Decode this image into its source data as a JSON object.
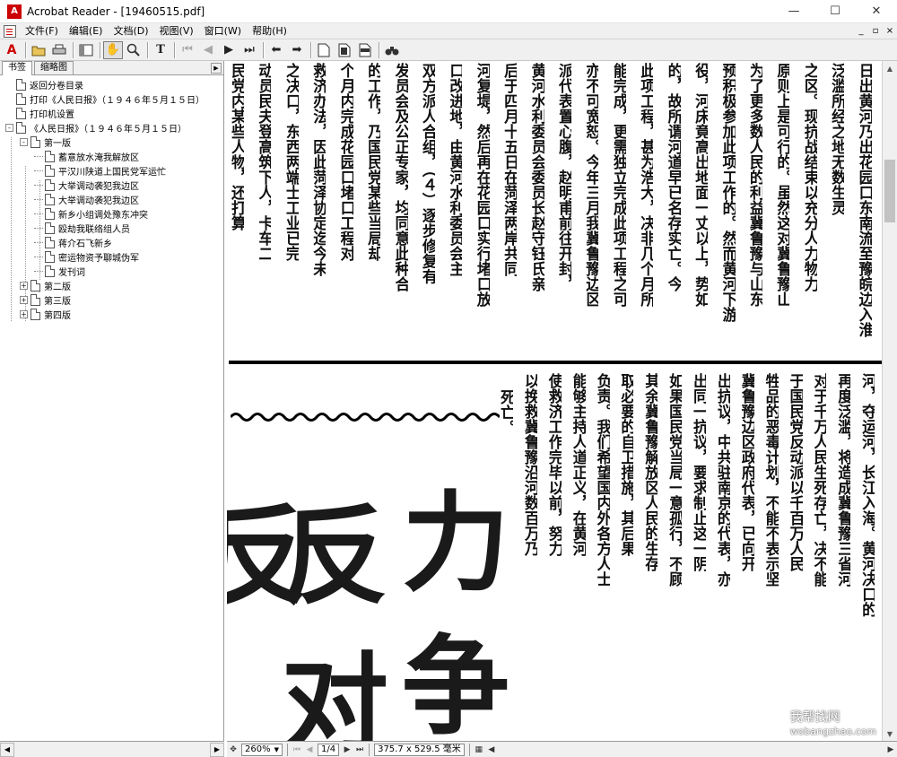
{
  "window": {
    "title": "Acrobat Reader - [19460515.pdf]",
    "app_icon_letter": "A",
    "controls": {
      "minimize": "—",
      "maximize": "☐",
      "close": "✕"
    }
  },
  "menubar": {
    "items": [
      "文件(F)",
      "编辑(E)",
      "文档(D)",
      "视图(V)",
      "窗口(W)",
      "帮助(H)"
    ],
    "mdi": {
      "minimize": "_",
      "restore": "▫",
      "close": "×"
    }
  },
  "nav_pane": {
    "tabs": [
      "书签",
      "缩略图"
    ],
    "tab_arrow": "▶",
    "bookmarks": [
      {
        "label": "返回分卷目录",
        "level": 0
      },
      {
        "label": "打印《人民日报》（１９４６年５月１５日）",
        "level": 0
      },
      {
        "label": "打印机设置",
        "level": 0
      },
      {
        "label": "《人民日报》（１９４６年５月１５日）",
        "level": 0,
        "expander": "-"
      },
      {
        "label": "第一版",
        "level": 1,
        "expander": "-"
      },
      {
        "label": "蓄意放水淹我解放区",
        "level": 2
      },
      {
        "label": "平汉川陕道上国民党军运忙",
        "level": 2
      },
      {
        "label": "大举调动袭犯我边区",
        "level": 2
      },
      {
        "label": "大举调动袭犯我边区",
        "level": 2
      },
      {
        "label": "新乡小组调处豫东冲突",
        "level": 2
      },
      {
        "label": "殴劫我联络组人员",
        "level": 2
      },
      {
        "label": "蒋介石飞新乡",
        "level": 2
      },
      {
        "label": "密运物资予聊城伪军",
        "level": 2
      },
      {
        "label": "发刊词",
        "level": 2
      },
      {
        "label": "第二版",
        "level": 1,
        "expander": "+"
      },
      {
        "label": "第三版",
        "level": 1,
        "expander": "+"
      },
      {
        "label": "第四版",
        "level": 1,
        "expander": "+"
      }
    ]
  },
  "statusbar": {
    "zoom": "260%",
    "page": "1/4",
    "page_size": "375.7 x 529.5 毫米"
  },
  "newspaper": {
    "upper_columns": [
      "日出黄河乃出花园口东南流至豫皖边入淮",
      "泛滥所经之地无数生灵",
      "之区。现抗战结束以充分人力物力",
      "原则上是可行的。虽然这对冀鲁豫山",
      "为了更多数人民的利益冀鲁豫与山东",
      "预积极参加此项工作的。然而黄河下游",
      "役，河床竟高出地面一丈以上，势如",
      "的，故所谓河道早已名存实亡。今",
      "此项工程，甚为浩大，决非几个月所",
      "能完成，更需独立完成此项工程之可",
      "亦不可宽恕。今年三月我冀鲁豫边区",
      "派代表置心腹，赵明甫前往开封，",
      "黄河水利委员会委员长赵守钰氏亲",
      "后于四月十五日在菏泽两岸共同",
      "河复堤，然后再在花园口实行堵口放",
      "口改进地，由黄河水利委员会主",
      "双方派人合组，（４）逐步修复有",
      "发员会及公正专家，均同意此种合",
      "的工作，乃国民党某些当局却",
      "个月内完成花园口堵口工程对",
      "救济办法，因此菏泽协定迄今未",
      "之决口，东西两端士工业已完",
      "动员民夫登高筑下人，卡车二",
      "民党内某些人物，还打算"
    ],
    "lower_columns": [
      "河，夺运河，长江入海。黄河决口的",
      "再度泛滥，将造成冀鲁豫三省河",
      "对于千万人民生死存亡，决不能",
      "于国民党反动派以千百万人民",
      "牲品的恶毒计划，不能不表示坚",
      "冀鲁豫边区政府代表，已向开",
      "出抗议，中共驻南京的代表，亦",
      "出同一抗议，要求制止这一阴",
      "如果国民党当局一意孤行，不顾",
      "其余冀鲁豫解放区人民的生存",
      "取必要的自卫措施，其后果",
      "负责。我们希望国内外各方人士",
      "能够主持人道正义，在黄河",
      "使救济工作完毕以前，努力",
      "以挽救冀鲁豫沿河数百万乃",
      "死亡。"
    ],
    "headline_chars": [
      "反",
      "对",
      "力",
      "争"
    ],
    "watermark": {
      "text": "我帮找网",
      "url": "wobangzhao.com"
    }
  }
}
